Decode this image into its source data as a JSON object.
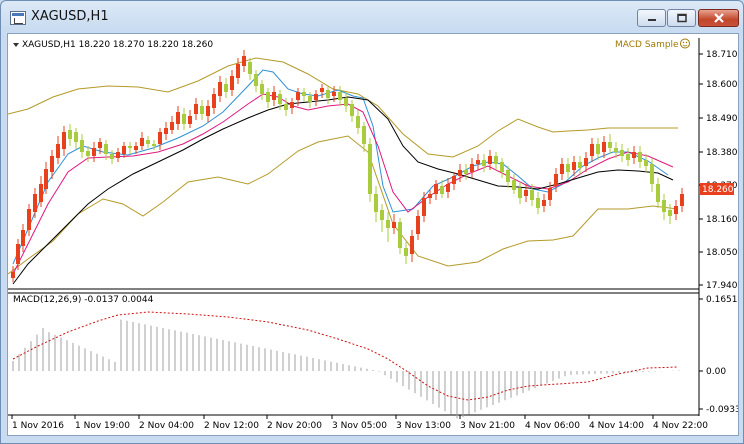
{
  "window": {
    "title": "XAGUSD,H1"
  },
  "chart": {
    "header": "XAGUSD,H1  18.220 18.270 18.220 18.260",
    "indicator_name": "MACD Sample",
    "price_ticks": [
      "18.710",
      "18.600",
      "18.490",
      "18.380",
      "18.270",
      "18.160",
      "18.050",
      "17.940"
    ],
    "current_price": "18.260",
    "macd_label": "MACD(12,26,9) -0.0137 0.0044",
    "macd_ticks": [
      "0.1651",
      "0.00",
      "-0.0933"
    ],
    "time_labels": [
      "1 Nov 2016",
      "1 Nov 19:00",
      "2 Nov 04:00",
      "2 Nov 12:00",
      "2 Nov 20:00",
      "3 Nov 05:00",
      "3 Nov 13:00",
      "3 Nov 21:00",
      "4 Nov 06:00",
      "4 Nov 14:00",
      "4 Nov 22:00"
    ]
  },
  "colors": {
    "bull": "#e8401c",
    "bear": "#a8cc3e",
    "upper_band": "#b49a28",
    "ma_fast": "#2e8fd6",
    "ma_mid": "#e0187f",
    "ma_slow": "#000000",
    "macd_hist": "#a0a0a0",
    "macd_signal": "#cc1111",
    "grid": "#c7c7c7",
    "price_tag": "#e8401c"
  },
  "icons": {
    "app": "chart-window-icon",
    "minimize": "minimize-icon",
    "maximize": "maximize-icon",
    "close": "close-icon",
    "smiley": "smiley-icon",
    "dropdown": "triangle-down-icon"
  }
}
